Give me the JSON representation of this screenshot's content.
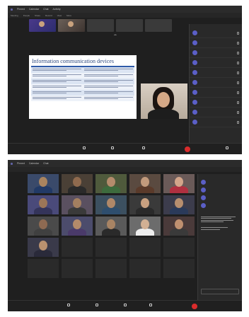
{
  "shot1": {
    "menubar": {
      "items": [
        "Pinned",
        "Calendar",
        "Chat",
        "Activity"
      ]
    },
    "menubar2": {
      "items": [
        "Meeting",
        "People",
        "Share",
        "Record",
        "View",
        "More"
      ]
    },
    "strip_tiles": [
      "",
      "",
      "",
      "",
      ""
    ],
    "share_label": "",
    "slide": {
      "title": "Information communication devices",
      "columns": [
        "",
        ""
      ],
      "rows": 5
    },
    "panel": {
      "title": "",
      "participants": [
        "",
        "",
        "",
        "",
        "",
        "",
        "",
        "",
        "",
        ""
      ]
    },
    "bottombar": {
      "items": [
        "",
        "",
        "",
        ""
      ]
    }
  },
  "shot2": {
    "menubar": {
      "items": [
        "Pinned",
        "Calendar",
        "Chat"
      ]
    },
    "tiles": [
      {
        "name": "",
        "skin": "#a9845f",
        "shirt": "#223a66",
        "bg": "#3a4a6a"
      },
      {
        "name": "",
        "skin": "#8f6a4e",
        "shirt": "#2a2a2a",
        "bg": "#4a4036"
      },
      {
        "name": "",
        "skin": "#b48b6c",
        "shirt": "#3d6b3d",
        "bg": "#4f5a3c"
      },
      {
        "name": "",
        "skin": "#c29a7c",
        "shirt": "#5a3a2a",
        "bg": "#5a4a40"
      },
      {
        "name": "",
        "skin": "#d3a58a",
        "shirt": "#b03040",
        "bg": "#6a5a58"
      },
      {
        "name": "",
        "skin": "#9c7658",
        "shirt": "#34345a",
        "bg": "#4a4a7a"
      },
      {
        "name": "",
        "skin": "#a37f60",
        "shirt": "#3a3a3a",
        "bg": "#5a5060"
      },
      {
        "name": "",
        "skin": "#b08868",
        "shirt": "#2e4e6e",
        "bg": "#3c5060"
      },
      {
        "name": "",
        "skin": "#c8a080",
        "shirt": "#2a2a2a",
        "bg": "#3a3a3a"
      },
      {
        "name": "",
        "skin": "#b88e6e",
        "shirt": "#2a3a5a",
        "bg": "#3c3c4c"
      },
      {
        "name": "",
        "skin": "#8e6a52",
        "shirt": "#404040",
        "bg": "#4a4a4a"
      },
      {
        "name": "",
        "skin": "#b38a6a",
        "shirt": "#4a3a6a",
        "bg": "#4c4c6c"
      },
      {
        "name": "",
        "skin": "#a88464",
        "shirt": "#2a2a2a",
        "bg": "#5a5a5a"
      },
      {
        "name": "",
        "skin": "#d2b094",
        "shirt": "#eeeeee",
        "bg": "#6c6c6c"
      },
      {
        "name": "",
        "skin": "#c09070",
        "shirt": "#3a3a3a",
        "bg": "#4a3a3a"
      },
      {
        "name": "",
        "skin": "#b9916f",
        "shirt": "#2a2a3a",
        "bg": "#3a3a4a"
      },
      {
        "name": "",
        "skin": "",
        "shirt": "",
        "bg": ""
      },
      {
        "name": "",
        "skin": "",
        "shirt": "",
        "bg": ""
      },
      {
        "name": "",
        "skin": "",
        "shirt": "",
        "bg": ""
      },
      {
        "name": "",
        "skin": "",
        "shirt": "",
        "bg": ""
      },
      {
        "name": "",
        "skin": "",
        "shirt": "",
        "bg": ""
      },
      {
        "name": "",
        "skin": "",
        "shirt": "",
        "bg": ""
      },
      {
        "name": "",
        "skin": "",
        "shirt": "",
        "bg": ""
      },
      {
        "name": "",
        "skin": "",
        "shirt": "",
        "bg": ""
      },
      {
        "name": "",
        "skin": "",
        "shirt": "",
        "bg": ""
      }
    ],
    "chat": {
      "title": "",
      "rows": [
        "",
        "",
        "",
        ""
      ],
      "tabs": [
        "",
        ""
      ],
      "messages": 2,
      "input_placeholder": ""
    },
    "bottombar": {
      "items": [
        "",
        "",
        "",
        "",
        ""
      ]
    }
  },
  "colors": {
    "accent": "#6264a7",
    "leave": "#d92c2c",
    "slide_header": "#2f5aa8"
  }
}
